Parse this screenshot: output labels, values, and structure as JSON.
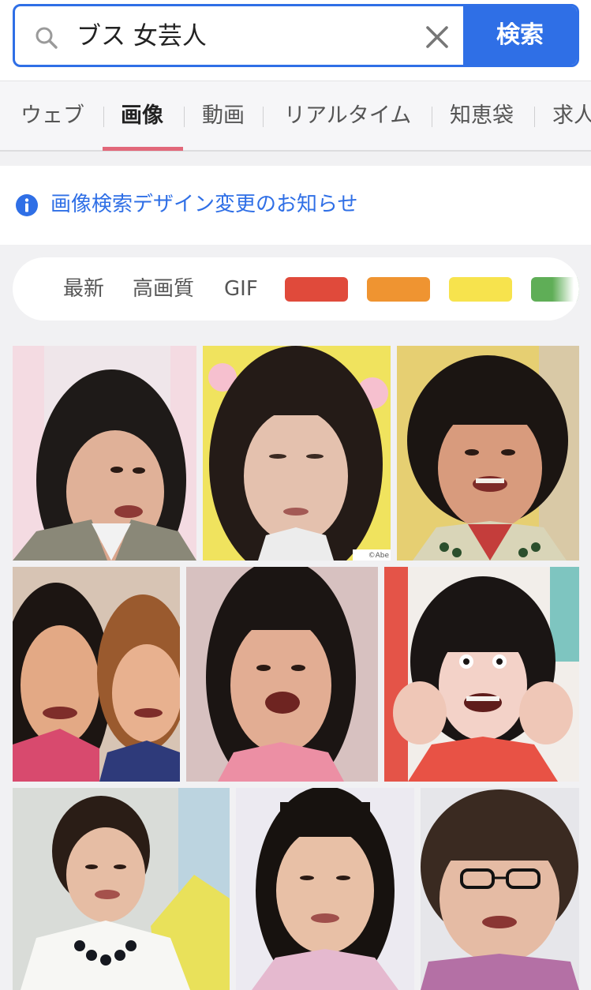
{
  "search": {
    "query": "ブス 女芸人",
    "button_label": "検索"
  },
  "tabs": [
    {
      "label": "ウェブ",
      "active": false
    },
    {
      "label": "画像",
      "active": true
    },
    {
      "label": "動画",
      "active": false
    },
    {
      "label": "リアルタイム",
      "active": false
    },
    {
      "label": "知恵袋",
      "active": false
    },
    {
      "label": "求人",
      "active": false
    }
  ],
  "notice": {
    "text": "画像検索デザイン変更のお知らせ"
  },
  "filters": {
    "items": [
      "最新",
      "高画質",
      "GIF"
    ],
    "colors": [
      "#e04a3b",
      "#ef9431",
      "#f7e34d",
      "#5fae57"
    ]
  },
  "results": [
    {
      "credit": ""
    },
    {
      "credit": "©Abe"
    },
    {
      "credit": ""
    },
    {
      "credit": ""
    },
    {
      "credit": ""
    },
    {
      "credit": ""
    },
    {
      "credit": ""
    },
    {
      "credit": ""
    },
    {
      "credit": ""
    }
  ],
  "colors": {
    "accent": "#2f6fe6",
    "tab_underline": "#e2687a"
  }
}
